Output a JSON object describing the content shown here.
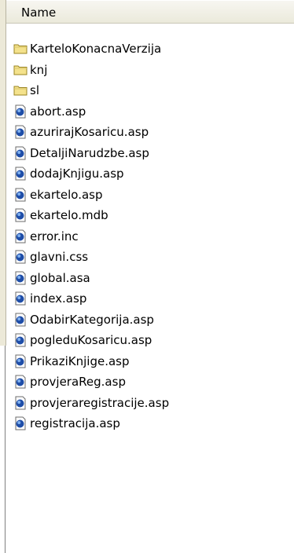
{
  "header": {
    "name_label": "Name"
  },
  "files": [
    {
      "name": "KarteloKonacnaVerzija",
      "type": "folder",
      "icon": "folder-icon"
    },
    {
      "name": "knj",
      "type": "folder",
      "icon": "folder-icon"
    },
    {
      "name": "sl",
      "type": "folder",
      "icon": "folder-icon"
    },
    {
      "name": "abort.asp",
      "type": "file",
      "icon": "script-file-icon"
    },
    {
      "name": "azurirajKosaricu.asp",
      "type": "file",
      "icon": "script-file-icon"
    },
    {
      "name": "DetaljiNarudzbe.asp",
      "type": "file",
      "icon": "script-file-icon"
    },
    {
      "name": "dodajKnjigu.asp",
      "type": "file",
      "icon": "script-file-icon"
    },
    {
      "name": "ekartelo.asp",
      "type": "file",
      "icon": "script-file-icon"
    },
    {
      "name": "ekartelo.mdb",
      "type": "file",
      "icon": "script-file-icon"
    },
    {
      "name": "error.inc",
      "type": "file",
      "icon": "script-file-icon"
    },
    {
      "name": "glavni.css",
      "type": "file",
      "icon": "script-file-icon"
    },
    {
      "name": "global.asa",
      "type": "file",
      "icon": "script-file-icon"
    },
    {
      "name": "index.asp",
      "type": "file",
      "icon": "script-file-icon"
    },
    {
      "name": "OdabirKategorija.asp",
      "type": "file",
      "icon": "script-file-icon"
    },
    {
      "name": "pogleduKosaricu.asp",
      "type": "file",
      "icon": "script-file-icon"
    },
    {
      "name": "PrikaziKnjige.asp",
      "type": "file",
      "icon": "script-file-icon"
    },
    {
      "name": "provjeraReg.asp",
      "type": "file",
      "icon": "script-file-icon"
    },
    {
      "name": "provjeraregistracije.asp",
      "type": "file",
      "icon": "script-file-icon"
    },
    {
      "name": "registracija.asp",
      "type": "file",
      "icon": "script-file-icon"
    }
  ],
  "colors": {
    "folder_fill": "#f4e28c",
    "folder_border": "#9a8422",
    "file_blue": "#1f4ea8",
    "file_light": "#7fb0f0"
  }
}
